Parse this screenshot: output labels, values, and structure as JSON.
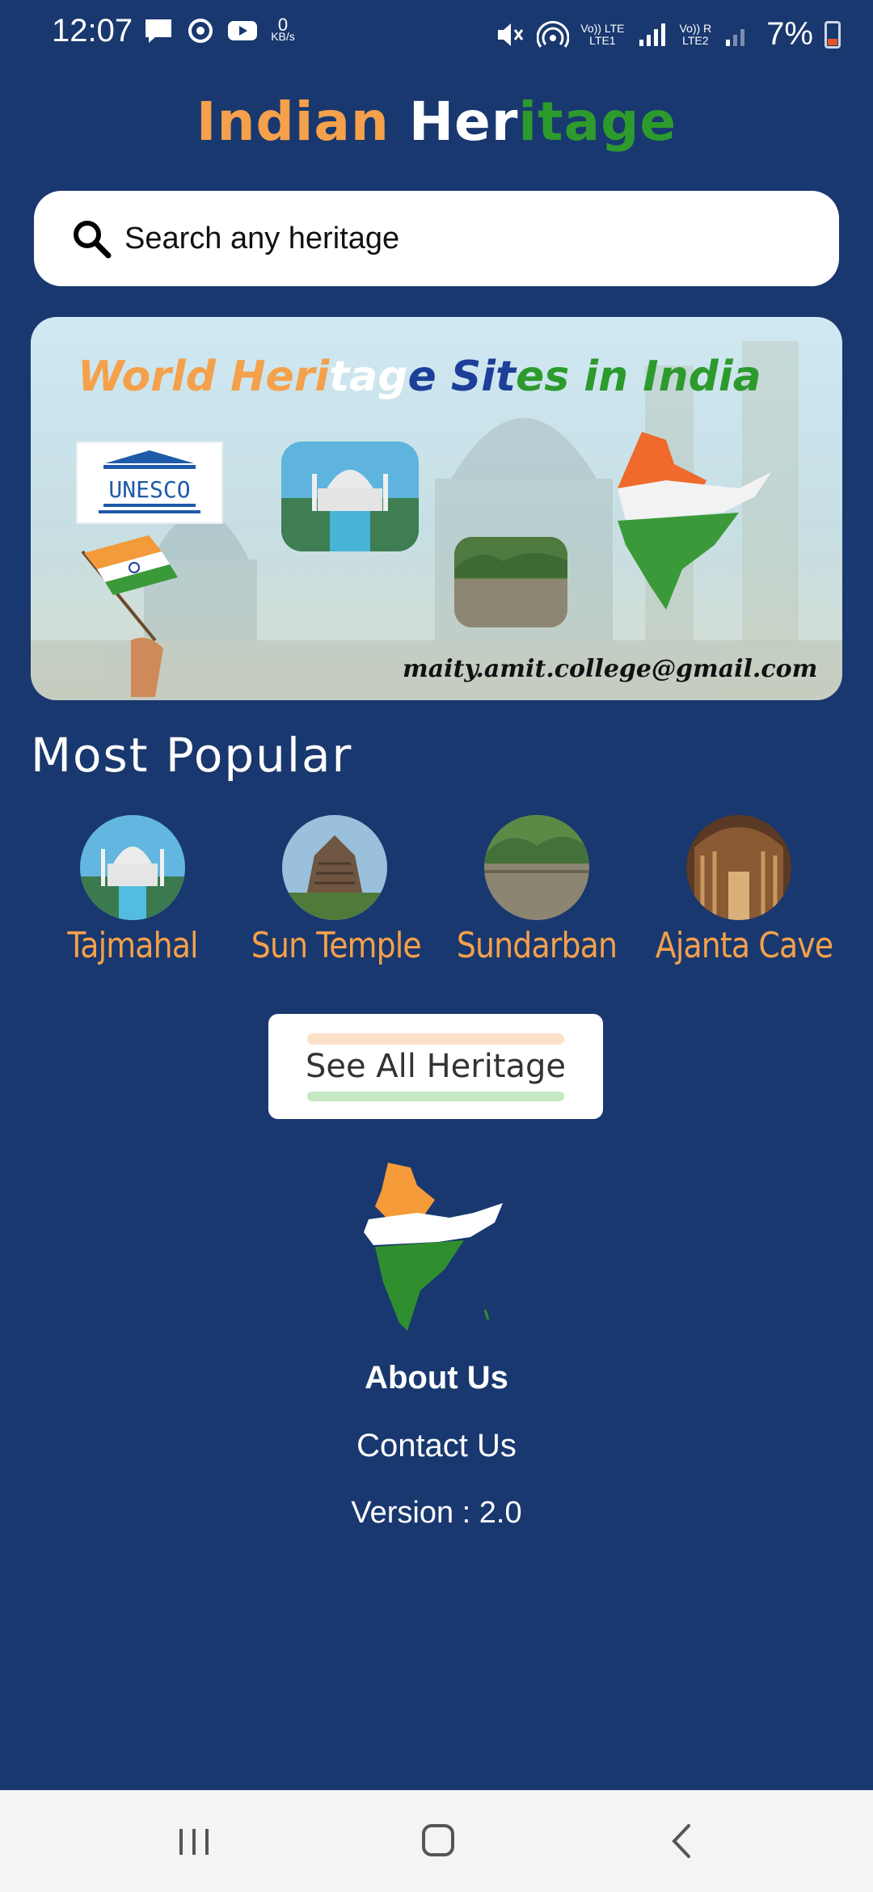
{
  "status_bar": {
    "time": "12:07",
    "speed_value": "0",
    "speed_unit": "KB/s",
    "sim1_line1": "Vo)) LTE",
    "sim1_line2": "LTE1",
    "sim2_line1": "Vo)) R",
    "sim2_line2": "LTE2",
    "battery": "7%",
    "icons": [
      "message-icon",
      "sync-icon",
      "youtube-icon",
      "mute-icon",
      "hotspot-icon",
      "signal-icon",
      "battery-icon"
    ]
  },
  "app_title": {
    "part1": "Indian",
    "part2": " Her",
    "part3": "itage"
  },
  "search": {
    "placeholder": "Search any heritage"
  },
  "banner": {
    "title_part1": "World Heri",
    "title_part2": "tag",
    "title_part3": "e Sit",
    "title_part4": "es in India",
    "logo_text": "UNESCO",
    "email": "maity.amit.college@gmail.com"
  },
  "most_popular": {
    "title": "Most Popular",
    "items": [
      {
        "label": "Tajmahal"
      },
      {
        "label": "Sun Temple"
      },
      {
        "label": "Sundarban"
      },
      {
        "label": "Ajanta Cave"
      }
    ]
  },
  "see_all_label": "See All Heritage",
  "footer": {
    "about": "About Us",
    "contact": "Contact Us",
    "version": "Version : 2.0"
  },
  "colors": {
    "background": "#19386f",
    "saffron": "#f5a04a",
    "green": "#2d9a2d"
  }
}
